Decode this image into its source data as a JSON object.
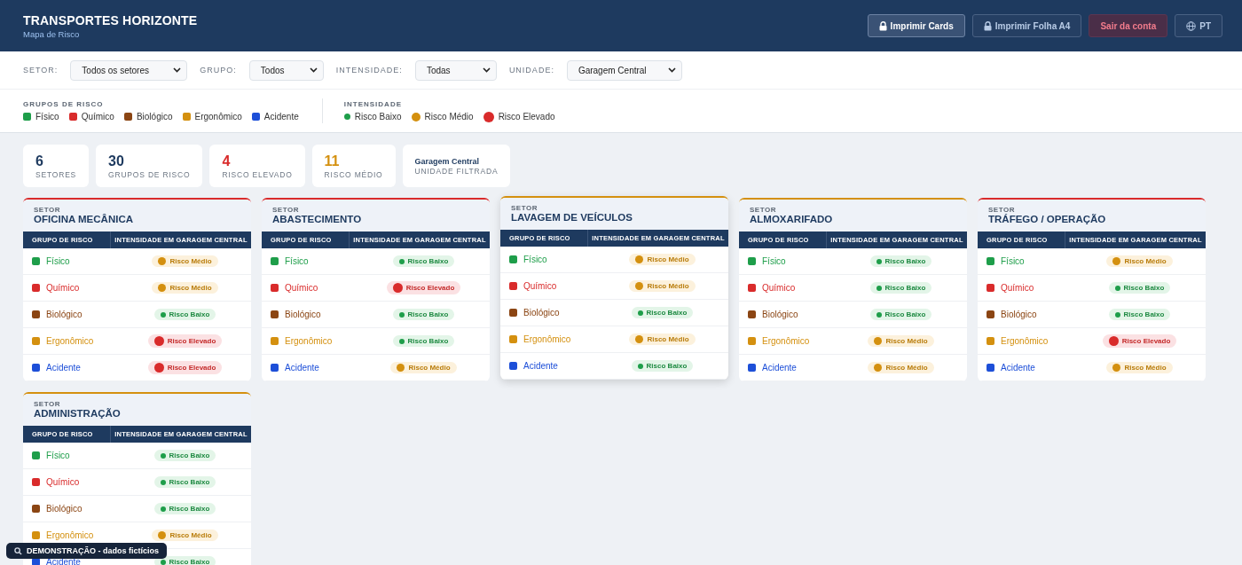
{
  "header": {
    "title": "TRANSPORTES HORIZONTE",
    "subtitle": "Mapa de Risco",
    "buttons": [
      {
        "label": "Imprimir Cards",
        "kind": "print",
        "selected": true
      },
      {
        "label": "Imprimir Folha A4",
        "kind": "print",
        "selected": false
      },
      {
        "label": "Sair da conta",
        "kind": "logout",
        "selected": false
      },
      {
        "label": "PT",
        "kind": "language",
        "selected": false
      }
    ]
  },
  "filters": [
    {
      "label": "SETOR:",
      "value": "Todos os setores"
    },
    {
      "label": "GRUPO:",
      "value": "Todos"
    },
    {
      "label": "INTENSIDADE:",
      "value": "Todas"
    },
    {
      "label": "UNIDADE:",
      "value": "Garagem Central"
    }
  ],
  "legend": {
    "groups_title": "GRUPOS DE RISCO",
    "groups": [
      {
        "label": "Físico",
        "color": "#1e9e4a"
      },
      {
        "label": "Químico",
        "color": "#d92b2b"
      },
      {
        "label": "Biológico",
        "color": "#8b4513"
      },
      {
        "label": "Ergonômico",
        "color": "#d4900f"
      },
      {
        "label": "Acidente",
        "color": "#1d4fd8"
      }
    ],
    "intensity_title": "INTENSIDADE",
    "intensities": [
      {
        "label": "Risco Baixo",
        "kind": "low"
      },
      {
        "label": "Risco Médio",
        "kind": "medium"
      },
      {
        "label": "Risco Elevado",
        "kind": "high"
      }
    ]
  },
  "stats": [
    {
      "value": "6",
      "label": "SETORES",
      "kind": "count"
    },
    {
      "value": "30",
      "label": "GRUPOS DE RISCO",
      "kind": "count"
    },
    {
      "value": "4",
      "label": "RISCO ELEVADO",
      "kind": "high"
    },
    {
      "value": "11",
      "label": "RISCO MÉDIO",
      "kind": "medium"
    },
    {
      "value": "Garagem Central",
      "label": "UNIDADE FILTRADA",
      "kind": "text"
    }
  ],
  "sectors": [
    {
      "caption": "SETOR",
      "name": "OFICINA MECÂNICA",
      "raised": false,
      "columns": [
        "GRUPO DE RISCO",
        "INTENSIDADE EM GARAGEM CENTRAL"
      ],
      "rows": [
        {
          "group": "Físico",
          "color": "#1e9e4a",
          "risk": "Risco Médio",
          "kind": "medium"
        },
        {
          "group": "Químico",
          "color": "#d92b2b",
          "risk": "Risco Médio",
          "kind": "medium"
        },
        {
          "group": "Biológico",
          "color": "#8b4513",
          "risk": "Risco Baixo",
          "kind": "low"
        },
        {
          "group": "Ergonômico",
          "color": "#d4900f",
          "risk": "Risco Elevado",
          "kind": "high"
        },
        {
          "group": "Acidente",
          "color": "#1d4fd8",
          "risk": "Risco Elevado",
          "kind": "high"
        }
      ]
    },
    {
      "caption": "SETOR",
      "name": "ABASTECIMENTO",
      "raised": false,
      "columns": [
        "GRUPO DE RISCO",
        "INTENSIDADE EM GARAGEM CENTRAL"
      ],
      "rows": [
        {
          "group": "Físico",
          "color": "#1e9e4a",
          "risk": "Risco Baixo",
          "kind": "low"
        },
        {
          "group": "Químico",
          "color": "#d92b2b",
          "risk": "Risco Elevado",
          "kind": "high"
        },
        {
          "group": "Biológico",
          "color": "#8b4513",
          "risk": "Risco Baixo",
          "kind": "low"
        },
        {
          "group": "Ergonômico",
          "color": "#d4900f",
          "risk": "Risco Baixo",
          "kind": "low"
        },
        {
          "group": "Acidente",
          "color": "#1d4fd8",
          "risk": "Risco Médio",
          "kind": "medium"
        }
      ]
    },
    {
      "caption": "SETOR",
      "name": "LAVAGEM DE VEÍCULOS",
      "raised": true,
      "columns": [
        "GRUPO DE RISCO",
        "INTENSIDADE EM GARAGEM CENTRAL"
      ],
      "rows": [
        {
          "group": "Físico",
          "color": "#1e9e4a",
          "risk": "Risco Médio",
          "kind": "medium"
        },
        {
          "group": "Químico",
          "color": "#d92b2b",
          "risk": "Risco Médio",
          "kind": "medium"
        },
        {
          "group": "Biológico",
          "color": "#8b4513",
          "risk": "Risco Baixo",
          "kind": "low"
        },
        {
          "group": "Ergonômico",
          "color": "#d4900f",
          "risk": "Risco Médio",
          "kind": "medium"
        },
        {
          "group": "Acidente",
          "color": "#1d4fd8",
          "risk": "Risco Baixo",
          "kind": "low"
        }
      ]
    },
    {
      "caption": "SETOR",
      "name": "ALMOXARIFADO",
      "raised": false,
      "columns": [
        "GRUPO DE RISCO",
        "INTENSIDADE EM GARAGEM CENTRAL"
      ],
      "rows": [
        {
          "group": "Físico",
          "color": "#1e9e4a",
          "risk": "Risco Baixo",
          "kind": "low"
        },
        {
          "group": "Químico",
          "color": "#d92b2b",
          "risk": "Risco Baixo",
          "kind": "low"
        },
        {
          "group": "Biológico",
          "color": "#8b4513",
          "risk": "Risco Baixo",
          "kind": "low"
        },
        {
          "group": "Ergonômico",
          "color": "#d4900f",
          "risk": "Risco Médio",
          "kind": "medium"
        },
        {
          "group": "Acidente",
          "color": "#1d4fd8",
          "risk": "Risco Médio",
          "kind": "medium"
        }
      ]
    },
    {
      "caption": "SETOR",
      "name": "TRÁFEGO / OPERAÇÃO",
      "raised": false,
      "columns": [
        "GRUPO DE RISCO",
        "INTENSIDADE EM GARAGEM CENTRAL"
      ],
      "rows": [
        {
          "group": "Físico",
          "color": "#1e9e4a",
          "risk": "Risco Médio",
          "kind": "medium"
        },
        {
          "group": "Químico",
          "color": "#d92b2b",
          "risk": "Risco Baixo",
          "kind": "low"
        },
        {
          "group": "Biológico",
          "color": "#8b4513",
          "risk": "Risco Baixo",
          "kind": "low"
        },
        {
          "group": "Ergonômico",
          "color": "#d4900f",
          "risk": "Risco Elevado",
          "kind": "high"
        },
        {
          "group": "Acidente",
          "color": "#1d4fd8",
          "risk": "Risco Médio",
          "kind": "medium"
        }
      ]
    },
    {
      "caption": "SETOR",
      "name": "ADMINISTRAÇÃO",
      "raised": false,
      "columns": [
        "GRUPO DE RISCO",
        "INTENSIDADE EM GARAGEM CENTRAL"
      ],
      "rows": [
        {
          "group": "Físico",
          "color": "#1e9e4a",
          "risk": "Risco Baixo",
          "kind": "low"
        },
        {
          "group": "Químico",
          "color": "#d92b2b",
          "risk": "Risco Baixo",
          "kind": "low"
        },
        {
          "group": "Biológico",
          "color": "#8b4513",
          "risk": "Risco Baixo",
          "kind": "low"
        },
        {
          "group": "Ergonômico",
          "color": "#d4900f",
          "risk": "Risco Médio",
          "kind": "medium"
        },
        {
          "group": "Acidente",
          "color": "#1d4fd8",
          "risk": "Risco Baixo",
          "kind": "low"
        }
      ]
    }
  ],
  "demo_badge": "DEMONSTRAÇÃO - dados fictícios"
}
